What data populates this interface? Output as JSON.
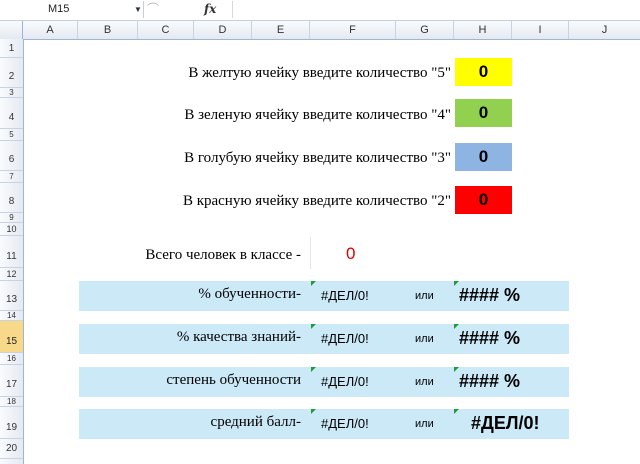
{
  "formula_bar": {
    "name_box": "M15",
    "fx": "fx",
    "formula": ""
  },
  "columns": [
    "A",
    "B",
    "C",
    "D",
    "E",
    "F",
    "G",
    "H",
    "I",
    "J"
  ],
  "rows": [
    "1",
    "2",
    "3",
    "4",
    "5",
    "6",
    "7",
    "8",
    "9",
    "10",
    "11",
    "12",
    "13",
    "14",
    "15",
    "16",
    "17",
    "18",
    "19",
    "20"
  ],
  "selected_row": "15",
  "inputs": [
    {
      "label": "В желтую ячейку введите количество \"5\"",
      "value": "0",
      "color": "#ffff00"
    },
    {
      "label": "В зеленую ячейку введите количество \"4\"",
      "value": "0",
      "color": "#92d050"
    },
    {
      "label": "В голубую  ячейку введите количество \"3\"",
      "value": "0",
      "color": "#8db4e2"
    },
    {
      "label": "В красную ячейку введите количество \"2\"",
      "value": "0",
      "color": "#ff0000"
    }
  ],
  "total": {
    "label": "Всего человек в классе -",
    "value": "0"
  },
  "results": [
    {
      "label": "% обученности-",
      "value": "#ДЕЛ/0!",
      "or": "или",
      "percent": "####  %"
    },
    {
      "label": "% качества знаний-",
      "value": "#ДЕЛ/0!",
      "or": "или",
      "percent": "####  %"
    },
    {
      "label": "степень обученности",
      "value": "#ДЕЛ/0!",
      "or": "или",
      "percent": "####  %"
    },
    {
      "label": "средний балл-",
      "value": "#ДЕЛ/0!",
      "or": "или",
      "percent": "#ДЕЛ/0!"
    }
  ],
  "colors": {
    "band": "#cce9f8",
    "error_total": "#e00000",
    "selected_row": "#f8d98a"
  }
}
